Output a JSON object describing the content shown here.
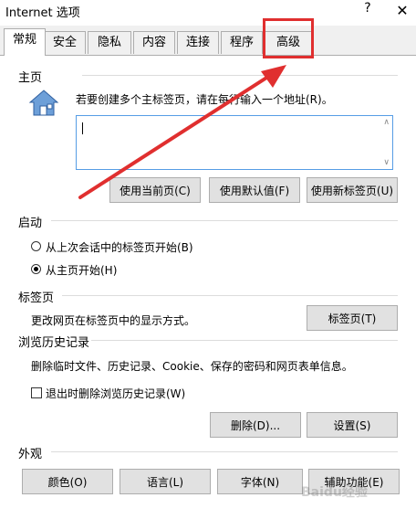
{
  "window": {
    "title": "Internet 选项",
    "help": "?",
    "close": "✕"
  },
  "tabs": [
    {
      "label": "常规"
    },
    {
      "label": "安全"
    },
    {
      "label": "隐私"
    },
    {
      "label": "内容"
    },
    {
      "label": "连接"
    },
    {
      "label": "程序"
    },
    {
      "label": "高级"
    }
  ],
  "homepage": {
    "group": "主页",
    "desc": "若要创建多个主标签页，请在每行输入一个地址(R)。",
    "address_value": "",
    "btn_current": "使用当前页(C)",
    "btn_default": "使用默认值(F)",
    "btn_newtab": "使用新标签页(U)"
  },
  "startup": {
    "group": "启动",
    "opt_last": "从上次会话中的标签页开始(B)",
    "opt_home": "从主页开始(H)"
  },
  "tabs_group": {
    "group": "标签页",
    "desc": "更改网页在标签页中的显示方式。",
    "btn": "标签页(T)"
  },
  "history": {
    "group": "浏览历史记录",
    "desc": "删除临时文件、历史记录、Cookie、保存的密码和网页表单信息。",
    "checkbox_label": "退出时删除浏览历史记录(W)",
    "btn_delete": "删除(D)...",
    "btn_settings": "设置(S)"
  },
  "appearance": {
    "group": "外观",
    "btn_colors": "颜色(O)",
    "btn_languages": "语言(L)",
    "btn_fonts": "字体(N)",
    "btn_accessibility": "辅助功能(E)"
  },
  "annotation": {
    "color": "#e02f2f"
  },
  "watermark": "Baidu经验"
}
